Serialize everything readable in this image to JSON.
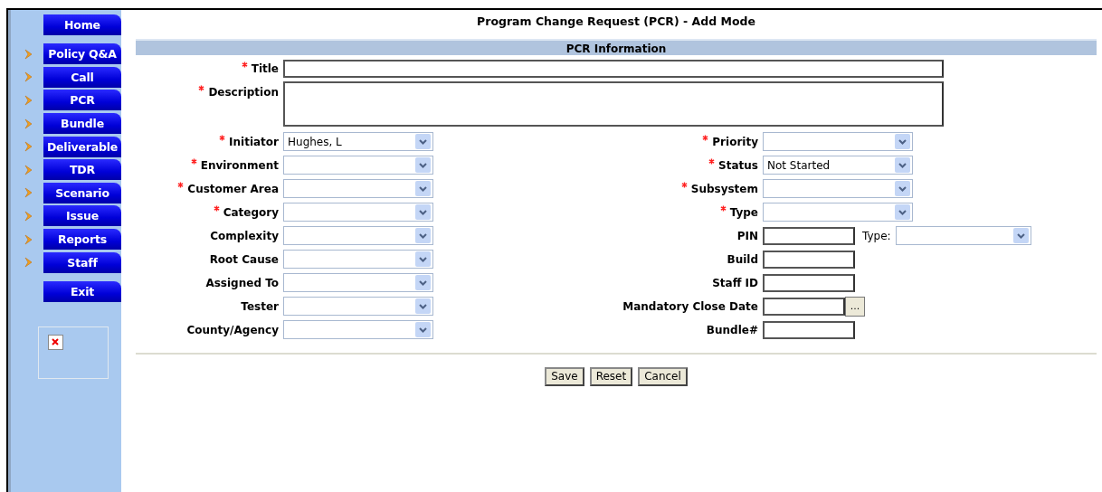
{
  "sidebar": {
    "items": [
      {
        "label": "Home",
        "kind": "top"
      },
      {
        "label": "Policy Q&A",
        "kind": "menu"
      },
      {
        "label": "Call",
        "kind": "menu"
      },
      {
        "label": "PCR",
        "kind": "menu"
      },
      {
        "label": "Bundle",
        "kind": "menu"
      },
      {
        "label": "Deliverable",
        "kind": "menu"
      },
      {
        "label": "TDR",
        "kind": "menu"
      },
      {
        "label": "Scenario",
        "kind": "menu"
      },
      {
        "label": "Issue",
        "kind": "menu"
      },
      {
        "label": "Reports",
        "kind": "menu"
      },
      {
        "label": "Staff",
        "kind": "menu"
      },
      {
        "label": "Exit",
        "kind": "exit"
      }
    ]
  },
  "page_title": "Program Change Request (PCR) - Add Mode",
  "section_title": "PCR Information",
  "title_field": {
    "label": "Title",
    "required": true
  },
  "description_field": {
    "label": "Description",
    "required": true
  },
  "left_fields": [
    {
      "label": "Initiator",
      "required": true,
      "kind": "select",
      "value": "Hughes, L"
    },
    {
      "label": "Environment",
      "required": true,
      "kind": "select"
    },
    {
      "label": "Customer Area",
      "required": true,
      "kind": "select"
    },
    {
      "label": "Category",
      "required": true,
      "kind": "select"
    },
    {
      "label": "Complexity",
      "required": false,
      "kind": "select"
    },
    {
      "label": "Root Cause",
      "required": false,
      "kind": "select"
    },
    {
      "label": "Assigned To",
      "required": false,
      "kind": "select"
    },
    {
      "label": "Tester",
      "required": false,
      "kind": "select"
    },
    {
      "label": "County/Agency",
      "required": false,
      "kind": "select"
    }
  ],
  "right_fields": [
    {
      "label": "Priority",
      "required": true,
      "kind": "select"
    },
    {
      "label": "Status",
      "required": true,
      "kind": "select",
      "value": "Not Started"
    },
    {
      "label": "Subsystem",
      "required": true,
      "kind": "select"
    },
    {
      "label": "Type",
      "required": true,
      "kind": "select"
    },
    {
      "label": "PIN",
      "required": false,
      "kind": "text",
      "extra_label": "Type:"
    },
    {
      "label": "Build",
      "required": false,
      "kind": "text"
    },
    {
      "label": "Staff ID",
      "required": false,
      "kind": "text"
    },
    {
      "label": "Mandatory Close Date",
      "required": false,
      "kind": "date",
      "picker": "..."
    },
    {
      "label": "Bundle#",
      "required": false,
      "kind": "text"
    }
  ],
  "buttons": [
    "Save",
    "Reset",
    "Cancel"
  ]
}
